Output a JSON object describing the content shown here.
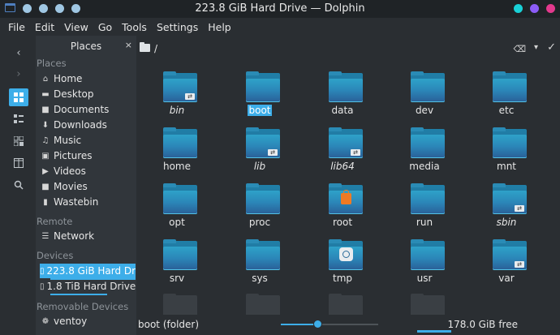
{
  "window": {
    "title": "223.8 GiB Hard Drive — Dolphin",
    "colors": {
      "dot_left": "#9fc7e3",
      "dot_cyan": "#19d1d7",
      "dot_purple": "#8b5cf6",
      "dot_pink": "#e3398d"
    }
  },
  "menu": [
    "File",
    "Edit",
    "View",
    "Go",
    "Tools",
    "Settings",
    "Help"
  ],
  "strip": [
    "back-icon",
    "forward-icon",
    "icons-view-icon",
    "compact-view-icon",
    "details-view-icon",
    "split-icon",
    "search-icon"
  ],
  "places": {
    "header": "Places",
    "close": "×",
    "sections": {
      "places": "Places",
      "remote": "Remote",
      "devices": "Devices",
      "removable": "Removable Devices"
    },
    "items": [
      {
        "label": "Home",
        "icon": "home-icon"
      },
      {
        "label": "Desktop",
        "icon": "desktop-icon"
      },
      {
        "label": "Documents",
        "icon": "documents-icon"
      },
      {
        "label": "Downloads",
        "icon": "downloads-icon"
      },
      {
        "label": "Music",
        "icon": "music-icon"
      },
      {
        "label": "Pictures",
        "icon": "pictures-icon"
      },
      {
        "label": "Videos",
        "icon": "videos-icon"
      },
      {
        "label": "Movies",
        "icon": "folder-icon"
      },
      {
        "label": "Wastebin",
        "icon": "trash-icon"
      }
    ],
    "remote": [
      {
        "label": "Network",
        "icon": "network-icon"
      }
    ],
    "devices": [
      {
        "label": "223.8 GiB Hard Dr...",
        "icon": "harddrive-icon",
        "selected": true
      },
      {
        "label": "1.8 TiB Hard Drive",
        "icon": "harddrive-icon"
      }
    ],
    "removable": [
      {
        "label": "ventoy",
        "icon": "usb-icon"
      }
    ]
  },
  "location": {
    "path": "/"
  },
  "files": [
    {
      "name": "bin",
      "italic": true,
      "badge": "link"
    },
    {
      "name": "boot",
      "italic": false,
      "selected": true
    },
    {
      "name": "data",
      "italic": false
    },
    {
      "name": "dev",
      "italic": false
    },
    {
      "name": "etc",
      "italic": false
    },
    {
      "name": "home",
      "italic": false
    },
    {
      "name": "lib",
      "italic": true,
      "badge": "link"
    },
    {
      "name": "lib64",
      "italic": true,
      "badge": "link"
    },
    {
      "name": "media",
      "italic": false
    },
    {
      "name": "mnt",
      "italic": false
    },
    {
      "name": "opt",
      "italic": false
    },
    {
      "name": "proc",
      "italic": false
    },
    {
      "name": "root",
      "italic": false,
      "badge": "lock"
    },
    {
      "name": "run",
      "italic": false
    },
    {
      "name": "sbin",
      "italic": true,
      "badge": "link"
    },
    {
      "name": "srv",
      "italic": false
    },
    {
      "name": "sys",
      "italic": false
    },
    {
      "name": "tmp",
      "italic": false,
      "badge": "clock"
    },
    {
      "name": "usr",
      "italic": false
    },
    {
      "name": "var",
      "italic": false,
      "badge": "link"
    }
  ],
  "status": {
    "selection": "boot (folder)",
    "zoom_fraction": 0.38,
    "free": "178.0 GiB free"
  }
}
